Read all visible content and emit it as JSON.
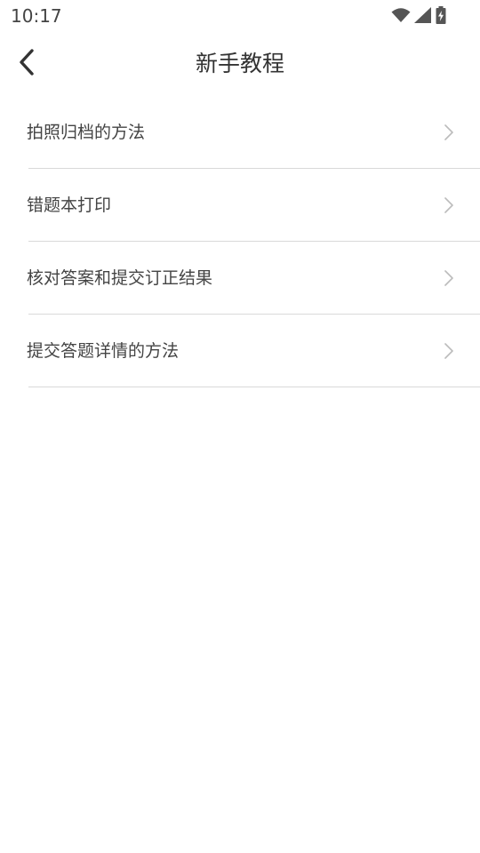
{
  "status_bar": {
    "time": "10:17",
    "icons": [
      "wifi-icon",
      "cellular-signal-icon",
      "battery-charging-icon"
    ]
  },
  "header": {
    "title": "新手教程",
    "back_icon": "chevron-left-icon"
  },
  "menu": {
    "items": [
      {
        "label": "拍照归档的方法"
      },
      {
        "label": "错题本打印"
      },
      {
        "label": "核对答案和提交订正结果"
      },
      {
        "label": "提交答题详情的方法"
      }
    ],
    "item_icon": "chevron-right-icon"
  },
  "colors": {
    "background": "#ffffff",
    "text": "#444444",
    "divider": "#d9d9d9",
    "chevron": "#bbbbbb"
  }
}
